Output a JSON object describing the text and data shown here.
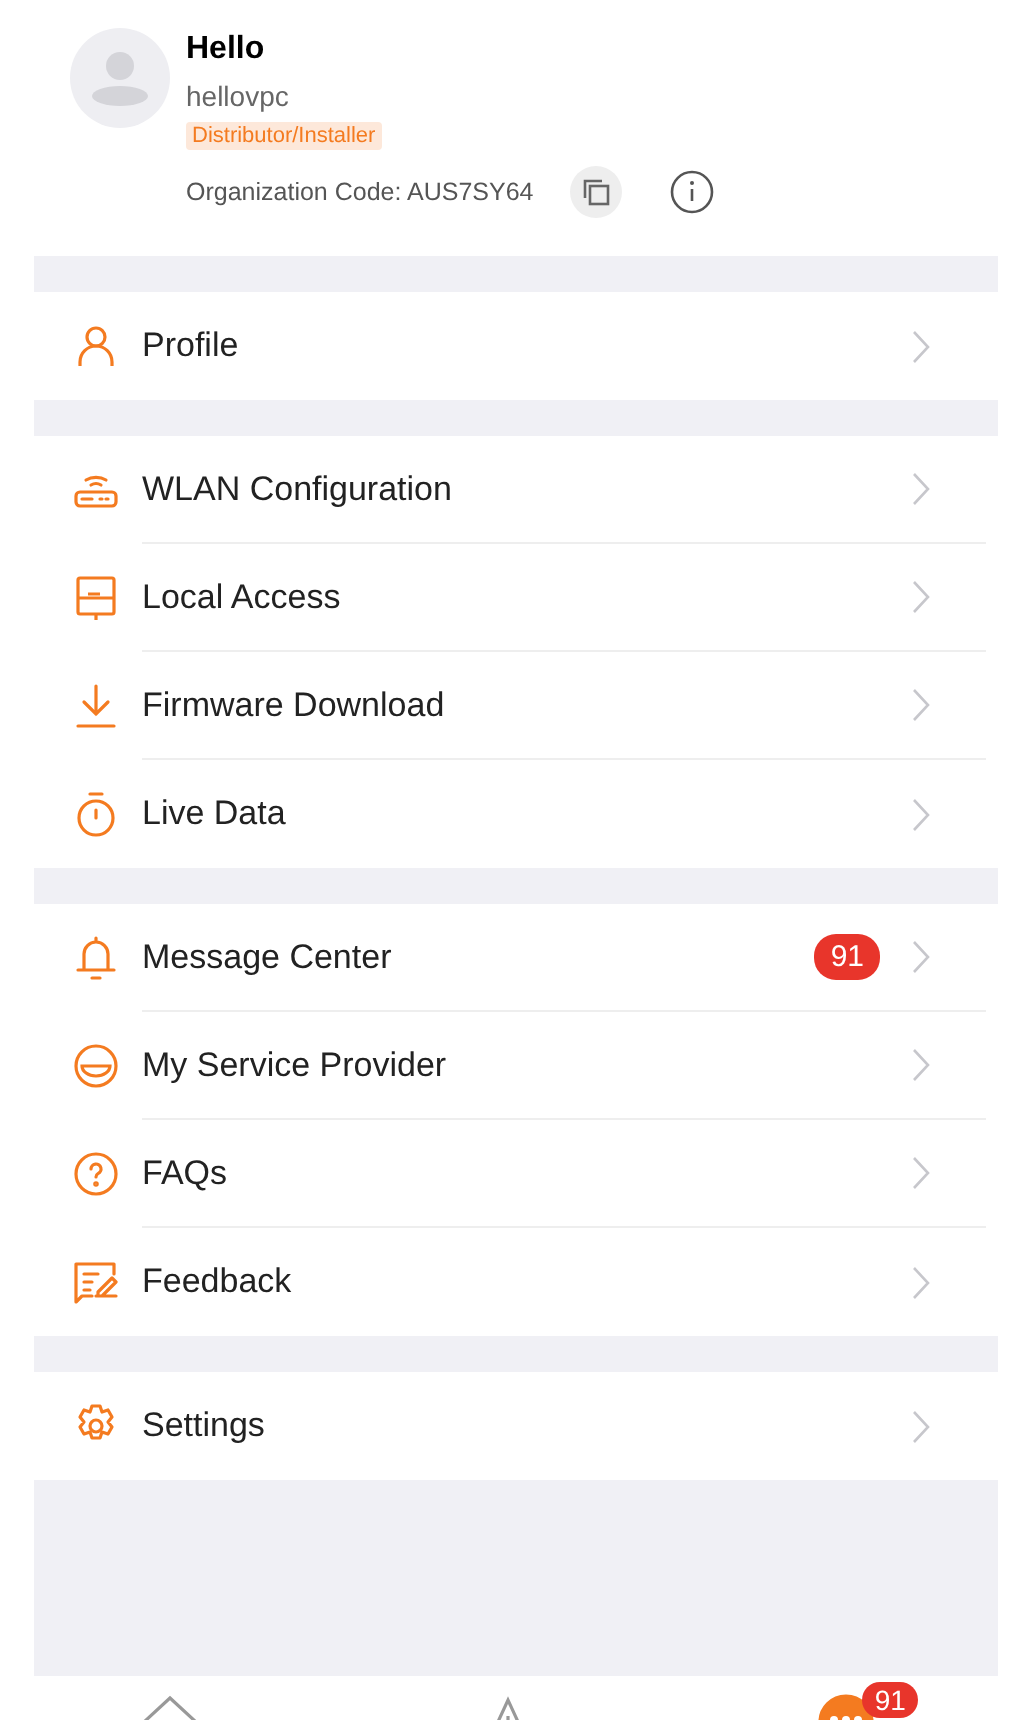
{
  "user": {
    "name": "Hello",
    "username": "hellovpc",
    "role_tag": "Distributor/Installer",
    "org_code": "Organization Code: AUS7SY64"
  },
  "groups": [
    {
      "items": [
        {
          "kind": "person",
          "label": "Profile"
        }
      ]
    },
    {
      "items": [
        {
          "kind": "router",
          "label": "WLAN Configuration"
        },
        {
          "kind": "device",
          "label": "Local Access"
        },
        {
          "kind": "download",
          "label": "Firmware Download"
        },
        {
          "kind": "timer",
          "label": "Live Data"
        }
      ]
    },
    {
      "items": [
        {
          "kind": "bell",
          "label": "Message Center",
          "badge": "91"
        },
        {
          "kind": "smile",
          "label": "My Service Provider"
        },
        {
          "kind": "question",
          "label": "FAQs"
        },
        {
          "kind": "feedback",
          "label": "Feedback"
        }
      ]
    },
    {
      "items": [
        {
          "kind": "gear",
          "label": "Settings"
        }
      ]
    }
  ],
  "tab_bar": [
    {
      "kind": "home",
      "selected": false
    },
    {
      "kind": "alert",
      "selected": false
    },
    {
      "kind": "more",
      "selected": true,
      "badge": "91"
    }
  ]
}
